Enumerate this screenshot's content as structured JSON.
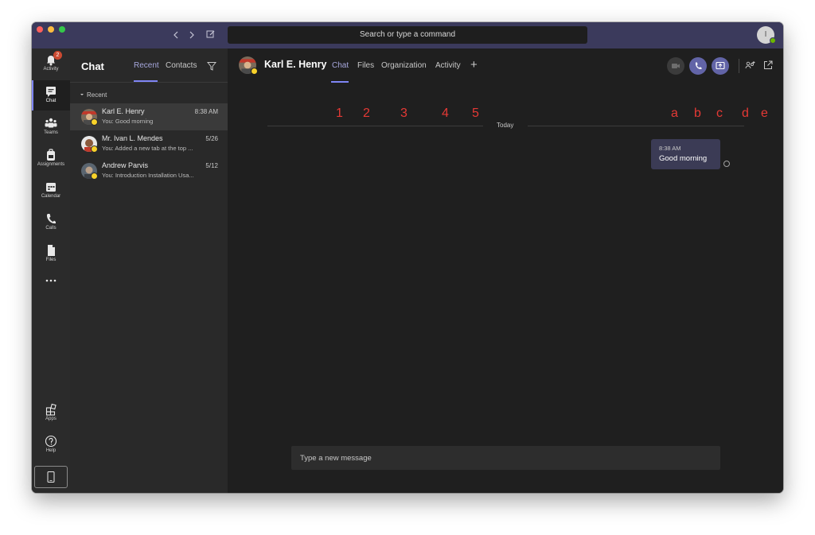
{
  "titlebar": {
    "search_placeholder": "Search or type a command",
    "user_initial": "I"
  },
  "rail": {
    "items": [
      {
        "label": "Activity",
        "badge": "2"
      },
      {
        "label": "Chat"
      },
      {
        "label": "Teams"
      },
      {
        "label": "Assignments"
      },
      {
        "label": "Calendar"
      },
      {
        "label": "Calls"
      },
      {
        "label": "Files"
      },
      {
        "label": "Apps"
      },
      {
        "label": "Help"
      }
    ]
  },
  "chat_list": {
    "title": "Chat",
    "tabs": [
      "Recent",
      "Contacts"
    ],
    "section": "Recent",
    "chats": [
      {
        "name": "Karl E. Henry",
        "time": "8:38 AM",
        "preview": "You: Good morning"
      },
      {
        "name": "Mr. Ivan L. Mendes",
        "time": "5/26",
        "preview": "You: Added a new tab at the top ..."
      },
      {
        "name": "Andrew Parvis",
        "time": "5/12",
        "preview": "You: Introduction Installation Usa..."
      }
    ]
  },
  "conversation": {
    "name": "Karl E. Henry",
    "tabs": [
      "Chat",
      "Files",
      "Organization",
      "Activity"
    ],
    "add_tab": "+",
    "annotations_numbers": [
      "1",
      "2",
      "3",
      "4",
      "5"
    ],
    "annotations_letters": [
      "a",
      "b",
      "c",
      "d",
      "e"
    ],
    "day_divider": "Today",
    "message": {
      "time": "8:38 AM",
      "text": "Good morning"
    },
    "composer_placeholder": "Type a new message"
  },
  "colors": {
    "titlebar": "#3b3a5c",
    "accent": "#6264a7",
    "accent_light": "#7f85f5",
    "annotation": "#e53935",
    "status_busy": "#f8d22a",
    "status_available": "#6bb700",
    "badge": "#cc4a31"
  }
}
